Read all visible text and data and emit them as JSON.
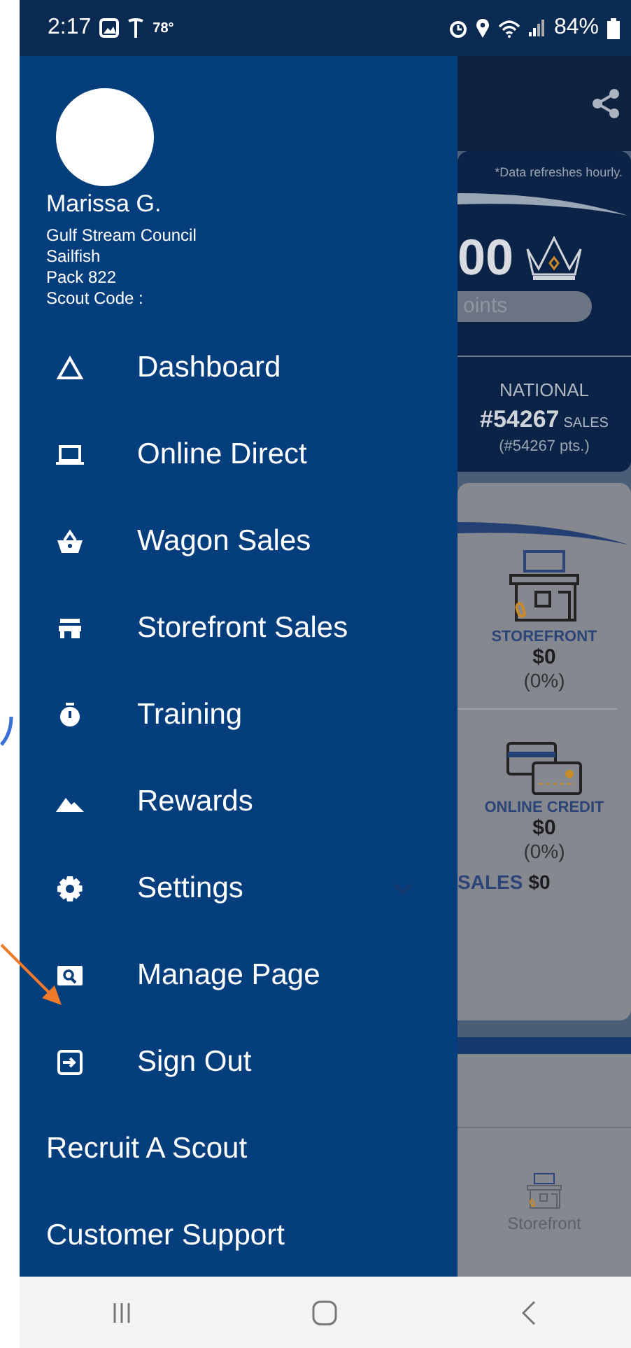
{
  "status_bar": {
    "time": "2:17",
    "temperature": "78°",
    "battery": "84%"
  },
  "drawer": {
    "user": {
      "name": "Marissa G.",
      "details": [
        "Gulf Stream Council",
        "Sailfish",
        "Pack 822",
        "Scout Code :"
      ]
    },
    "items": [
      {
        "kind": "icon",
        "label": "Dashboard"
      },
      {
        "kind": "icon",
        "label": "Online Direct"
      },
      {
        "kind": "icon",
        "label": "Wagon Sales"
      },
      {
        "kind": "icon",
        "label": "Storefront Sales"
      },
      {
        "kind": "icon",
        "label": "Training"
      },
      {
        "kind": "icon",
        "label": "Rewards"
      },
      {
        "kind": "expandable",
        "label": "Settings",
        "expanded": false
      },
      {
        "kind": "icon",
        "label": "Manage Page"
      },
      {
        "kind": "icon",
        "label": "Sign Out"
      },
      {
        "kind": "text",
        "label": "Recruit A Scout"
      },
      {
        "kind": "text",
        "label": "Customer Support"
      }
    ]
  },
  "background_page": {
    "note": "*Data refreshes hourly.",
    "points_value": "00",
    "points_label": "oints",
    "rank_label": "NATIONAL",
    "rank": "#54267",
    "rank_unit": "SALES",
    "rank_points": "(#54267 pts.)",
    "channels": [
      {
        "label": "STOREFRONT",
        "amount": "$0",
        "share": "(0%)"
      },
      {
        "label": "ONLINE CREDIT",
        "amount": "$0",
        "share": "(0%)"
      }
    ],
    "total_label": "SALES",
    "total": "$0",
    "tab": "Storefront"
  }
}
